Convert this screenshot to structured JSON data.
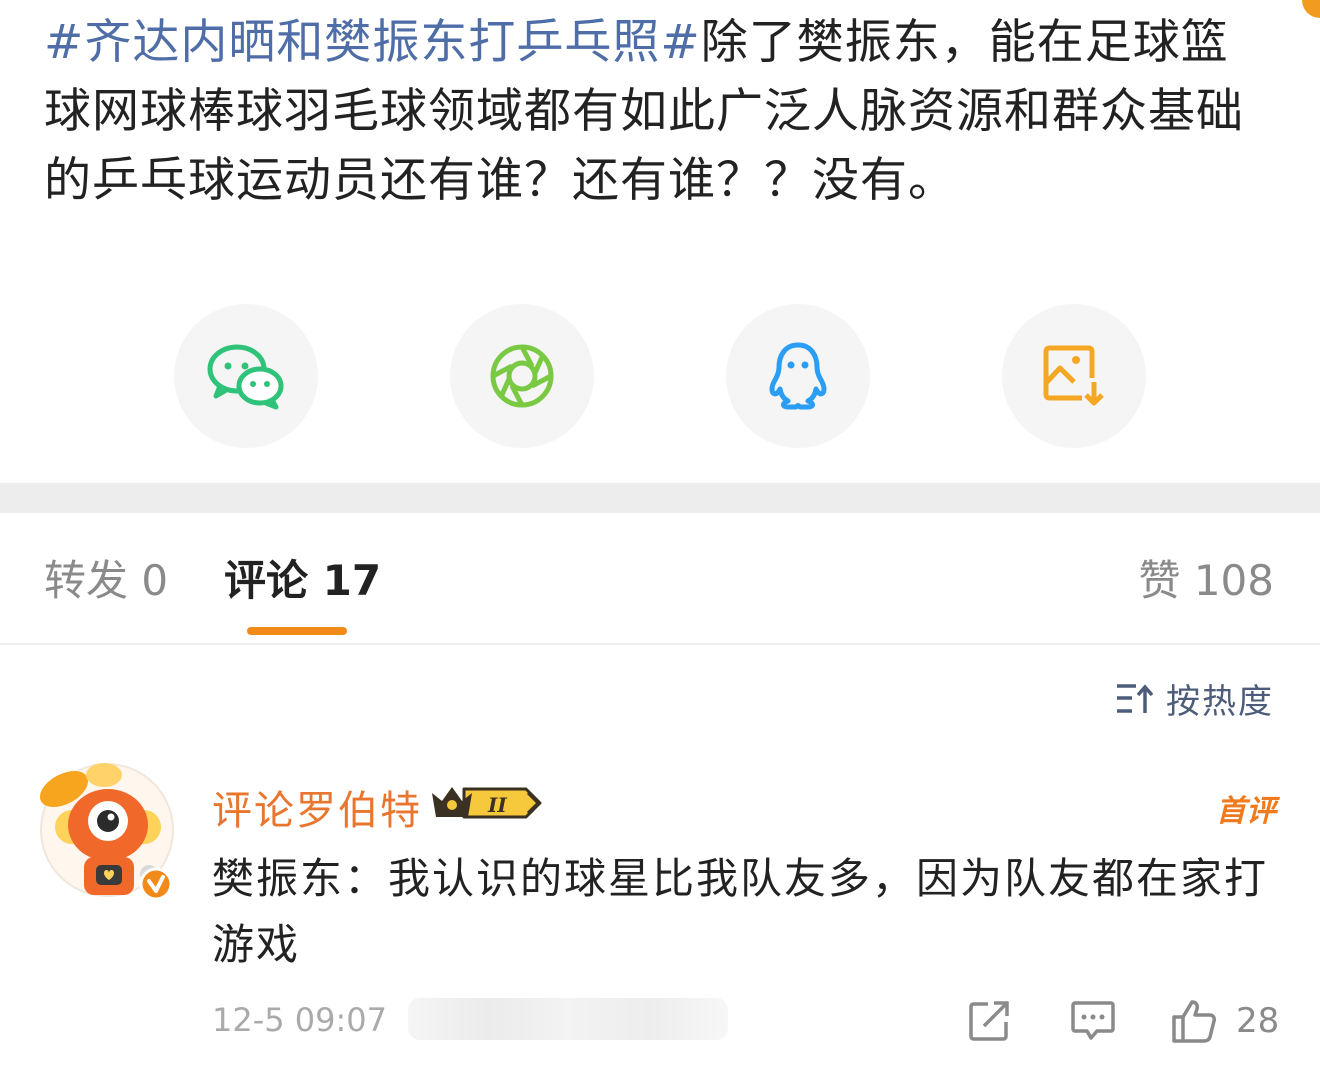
{
  "post": {
    "topic": "#齐达内晒和樊振东打乒乓照#",
    "text": "除了樊振东，能在足球篮球网球棒球羽毛球领域都有如此广泛人脉资源和群众基础的乒乓球运动员还有谁？还有谁？？没有。"
  },
  "share": {
    "items": [
      {
        "icon": "wechat-icon",
        "color": "#2fc37a"
      },
      {
        "icon": "moments-icon",
        "color": "#7ac943"
      },
      {
        "icon": "qq-icon",
        "color": "#2a9df4"
      },
      {
        "icon": "save-image-icon",
        "color": "#f5a623"
      }
    ]
  },
  "tabs": {
    "repost_label": "转发 0",
    "comment_label": "评论 17",
    "like_label": "赞 108",
    "active": "comment",
    "accent": "#f28a1a"
  },
  "sort": {
    "label": "按热度",
    "icon": "sort-icon"
  },
  "comment": {
    "user_name": "评论罗伯特",
    "badge_text": "II",
    "verified_icon": "verified-icon",
    "first_tag": "首评",
    "text": "樊振东：我认识的球星比我队友多，因为队友都在家打游戏",
    "time": "12-5 09:07",
    "like_count": "28",
    "name_color": "#e8762e"
  }
}
